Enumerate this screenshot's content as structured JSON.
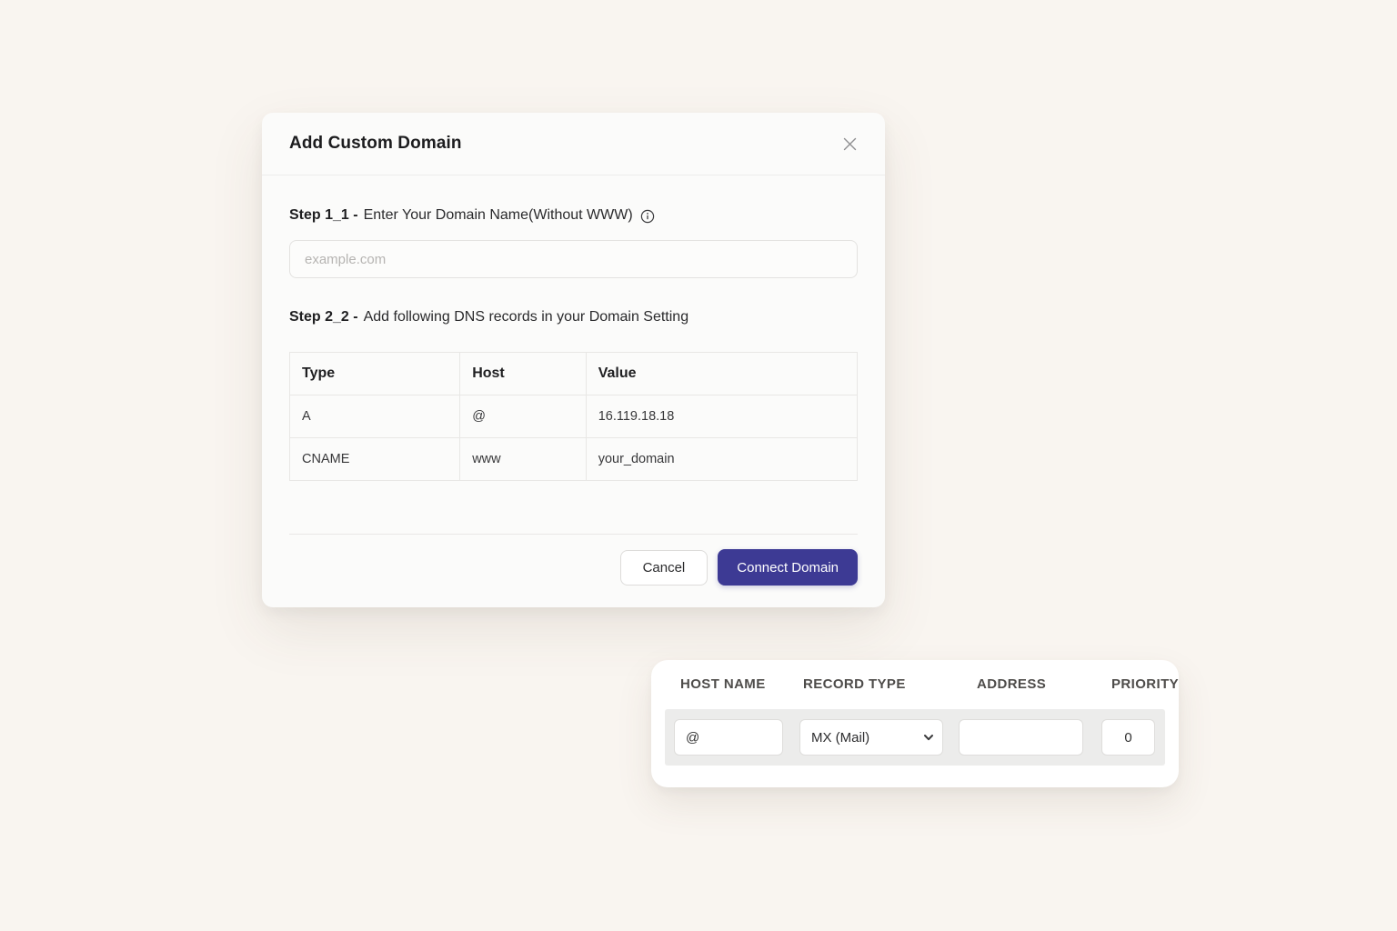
{
  "modal": {
    "title": "Add Custom Domain",
    "step1": {
      "label_bold": "Step 1_1 -",
      "label_rest": "Enter Your Domain Name(Without WWW)",
      "input_placeholder": "example.com",
      "input_value": ""
    },
    "step2": {
      "label_bold": "Step 2_2 -",
      "label_rest": "Add following DNS records in your Domain Setting"
    },
    "dns_table": {
      "headers": [
        "Type",
        "Host",
        "Value"
      ],
      "rows": [
        [
          "A",
          "@",
          "16.119.18.18"
        ],
        [
          "CNAME",
          "www",
          "your_domain"
        ]
      ]
    },
    "actions": {
      "cancel_label": "Cancel",
      "connect_label": "Connect Domain"
    }
  },
  "dns_form_panel": {
    "headers": [
      "HOST NAME",
      "RECORD TYPE",
      "ADDRESS",
      "PRIORITY"
    ],
    "host_name_value": "@",
    "record_type_selected": "MX (Mail)",
    "address_value": "",
    "priority_value": "0"
  },
  "colors": {
    "page_background": "#f9f5f0",
    "accent": "#3d3a94",
    "modal_background": "#fbfbfa",
    "panel_row_background": "#ececeb"
  }
}
